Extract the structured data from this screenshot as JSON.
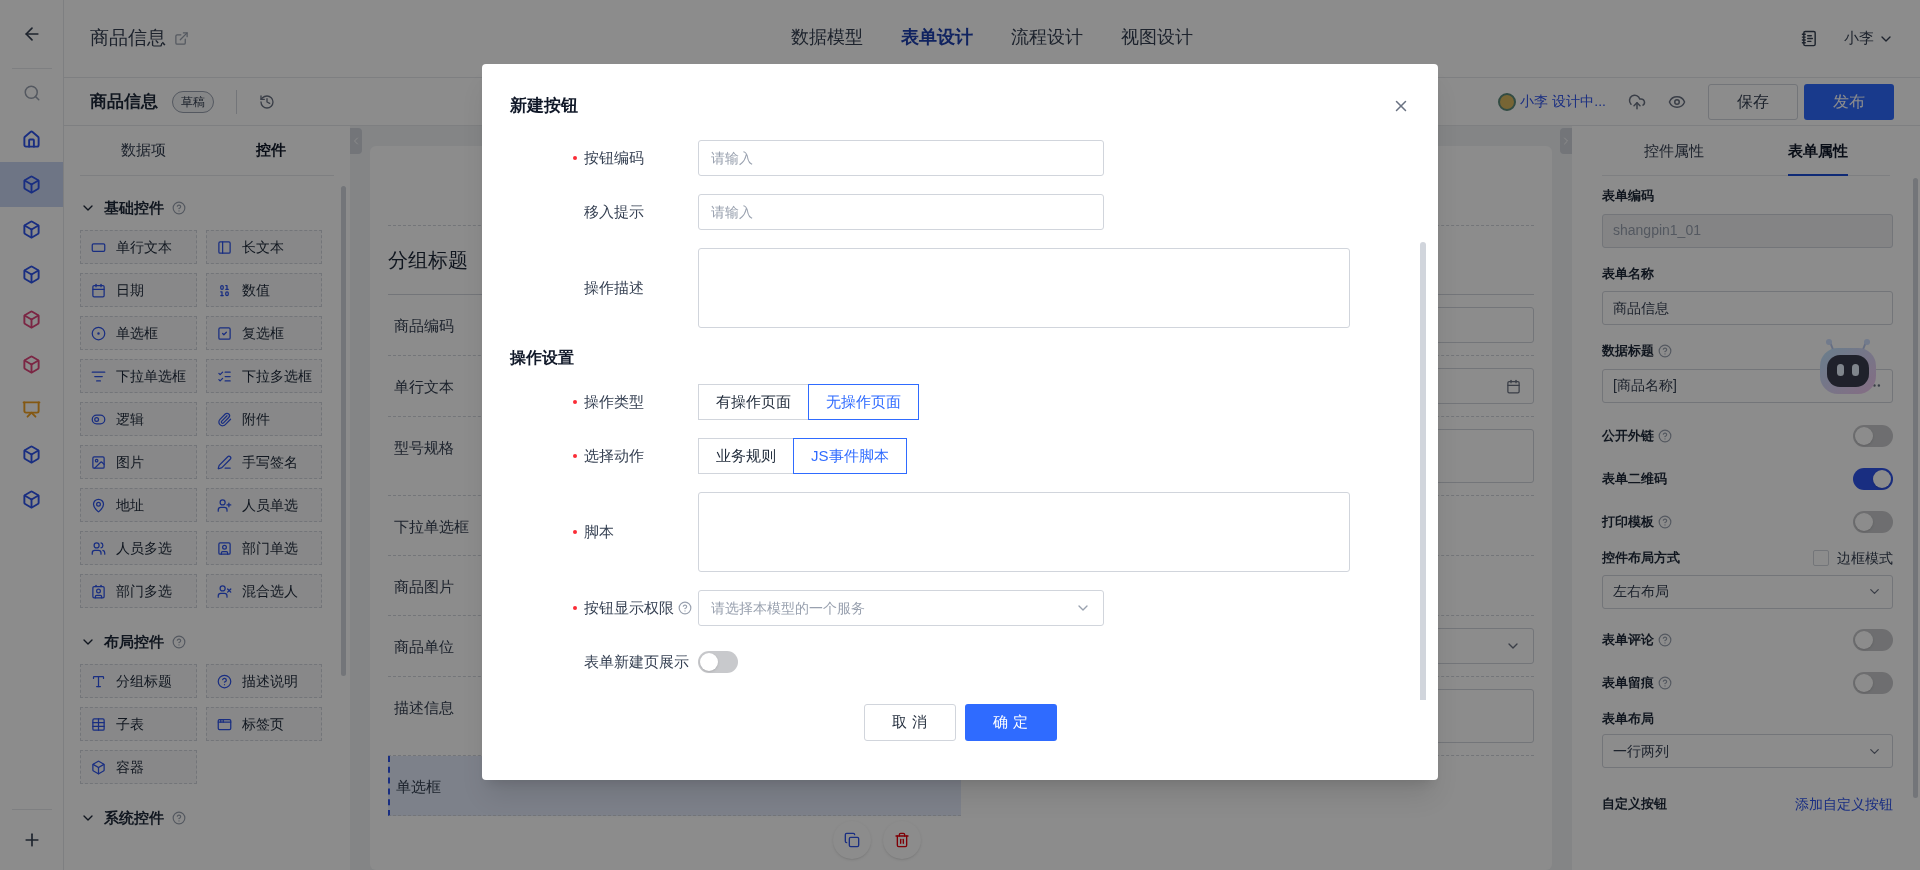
{
  "rail": {
    "nav": [
      {
        "kind": "home",
        "color": "#1a2e81",
        "selected": false
      },
      {
        "kind": "cube",
        "color": "#1a2e81",
        "selected": true
      },
      {
        "kind": "cube",
        "color": "#1a2e81",
        "selected": false
      },
      {
        "kind": "cube",
        "color": "#1a2e81",
        "selected": false
      },
      {
        "kind": "cube",
        "color": "#7b2644",
        "selected": false
      },
      {
        "kind": "cube",
        "color": "#7b2644",
        "selected": false
      },
      {
        "kind": "presentation",
        "color": "#845812",
        "selected": false
      },
      {
        "kind": "cube",
        "color": "#1a2e81",
        "selected": false
      },
      {
        "kind": "cube",
        "color": "#1a2e81",
        "selected": false
      }
    ]
  },
  "header": {
    "title": "商品信息",
    "tabs": [
      {
        "label": "数据模型",
        "selected": false
      },
      {
        "label": "表单设计",
        "selected": true
      },
      {
        "label": "流程设计",
        "selected": false
      },
      {
        "label": "视图设计",
        "selected": false
      }
    ],
    "user": "小李"
  },
  "toolbar": {
    "title": "商品信息",
    "badge": "草稿",
    "status": "小李 设计中...",
    "save": "保存",
    "publish": "发布"
  },
  "left_panel": {
    "tabs": [
      {
        "label": "数据项",
        "selected": false
      },
      {
        "label": "控件",
        "selected": true
      }
    ],
    "groups": [
      {
        "title": "基础控件",
        "expanded": true,
        "items": [
          {
            "label": "单行文本",
            "kind": "text"
          },
          {
            "label": "长文本",
            "kind": "longtext"
          },
          {
            "label": "日期",
            "kind": "date"
          },
          {
            "label": "数值",
            "kind": "number"
          },
          {
            "label": "单选框",
            "kind": "radio"
          },
          {
            "label": "复选框",
            "kind": "checkbox"
          },
          {
            "label": "下拉单选框",
            "kind": "dropdown"
          },
          {
            "label": "下拉多选框",
            "kind": "multidropdown"
          },
          {
            "label": "逻辑",
            "kind": "logic"
          },
          {
            "label": "附件",
            "kind": "attachment"
          },
          {
            "label": "图片",
            "kind": "image"
          },
          {
            "label": "手写签名",
            "kind": "signature"
          },
          {
            "label": "地址",
            "kind": "address"
          },
          {
            "label": "人员单选",
            "kind": "user"
          },
          {
            "label": "人员多选",
            "kind": "users"
          },
          {
            "label": "部门单选",
            "kind": "dept"
          },
          {
            "label": "部门多选",
            "kind": "depts"
          },
          {
            "label": "混合选人",
            "kind": "mixed"
          }
        ]
      },
      {
        "title": "布局控件",
        "expanded": true,
        "items": [
          {
            "label": "分组标题",
            "kind": "title"
          },
          {
            "label": "描述说明",
            "kind": "help"
          },
          {
            "label": "子表",
            "kind": "table"
          },
          {
            "label": "标签页",
            "kind": "tabs"
          },
          {
            "label": "容器",
            "kind": "container"
          }
        ]
      },
      {
        "title": "系统控件",
        "expanded": true
      }
    ]
  },
  "canvas": {
    "group_title": "分组标题",
    "fields": [
      {
        "label": "商品编码",
        "kind": "input",
        "selected": false
      },
      {
        "label": "单行文本",
        "kind": "date",
        "selected": false
      },
      {
        "label": "型号规格",
        "kind": "textarea",
        "selected": false
      },
      {
        "label": "下拉单选框",
        "kind": "none",
        "selected": false
      },
      {
        "label": "商品图片",
        "kind": "none",
        "selected": false
      },
      {
        "label": "商品单位",
        "kind": "select",
        "selected": false
      },
      {
        "label": "描述信息",
        "kind": "textarea",
        "selected": false
      },
      {
        "label": "单选框",
        "kind": "radio",
        "selected": true
      }
    ]
  },
  "right_panel": {
    "tabs": [
      {
        "label": "控件属性",
        "selected": false
      },
      {
        "label": "表单属性",
        "selected": true
      }
    ],
    "items": [
      {
        "kind": "input",
        "label": "表单编码",
        "value": "shangpin1_01",
        "disabled": true
      },
      {
        "kind": "input",
        "label": "表单名称",
        "value": "商品信息",
        "disabled": false
      },
      {
        "kind": "picker",
        "label": "数据标题",
        "help": true,
        "value": "[商品名称]"
      },
      {
        "kind": "switch",
        "label": "公开外链",
        "help": true,
        "on": false
      },
      {
        "kind": "switch",
        "label": "表单二维码",
        "help": false,
        "on": true
      },
      {
        "kind": "switch",
        "label": "打印模板",
        "help": true,
        "on": false
      },
      {
        "kind": "select",
        "label": "控件布局方式",
        "value": "左右布局",
        "option": {
          "label": "边框模式",
          "checked": false
        }
      },
      {
        "kind": "switch",
        "label": "表单评论",
        "help": true,
        "on": false
      },
      {
        "kind": "switch",
        "label": "表单留痕",
        "help": true,
        "on": false
      },
      {
        "kind": "select",
        "label": "表单布局",
        "value": "一行两列"
      },
      {
        "kind": "link",
        "label": "自定义按钮",
        "link": "添加自定义按钮"
      }
    ]
  },
  "modal": {
    "title": "新建按钮",
    "fields": [
      {
        "kind": "input",
        "label": "按钮编码",
        "required": true,
        "placeholder": "请输入"
      },
      {
        "kind": "input",
        "label": "移入提示",
        "required": false,
        "placeholder": "请输入"
      },
      {
        "kind": "textarea",
        "label": "操作描述",
        "required": false
      },
      {
        "kind": "section",
        "label": "操作设置"
      },
      {
        "kind": "segmented",
        "label": "操作类型",
        "required": true,
        "options": [
          {
            "label": "有操作页面",
            "selected": false
          },
          {
            "label": "无操作页面",
            "selected": true
          }
        ]
      },
      {
        "kind": "segmented",
        "label": "选择动作",
        "required": true,
        "options": [
          {
            "label": "业务规则",
            "selected": false
          },
          {
            "label": "JS事件脚本",
            "selected": true
          }
        ]
      },
      {
        "kind": "textarea",
        "label": "脚本",
        "required": true
      },
      {
        "kind": "select",
        "label": "按钮显示权限",
        "required": true,
        "help": true,
        "placeholder": "请选择本模型的一个服务"
      },
      {
        "kind": "switch",
        "label": "表单新建页展示",
        "required": false,
        "on": false
      }
    ],
    "cancel": "取 消",
    "ok": "确 定"
  }
}
